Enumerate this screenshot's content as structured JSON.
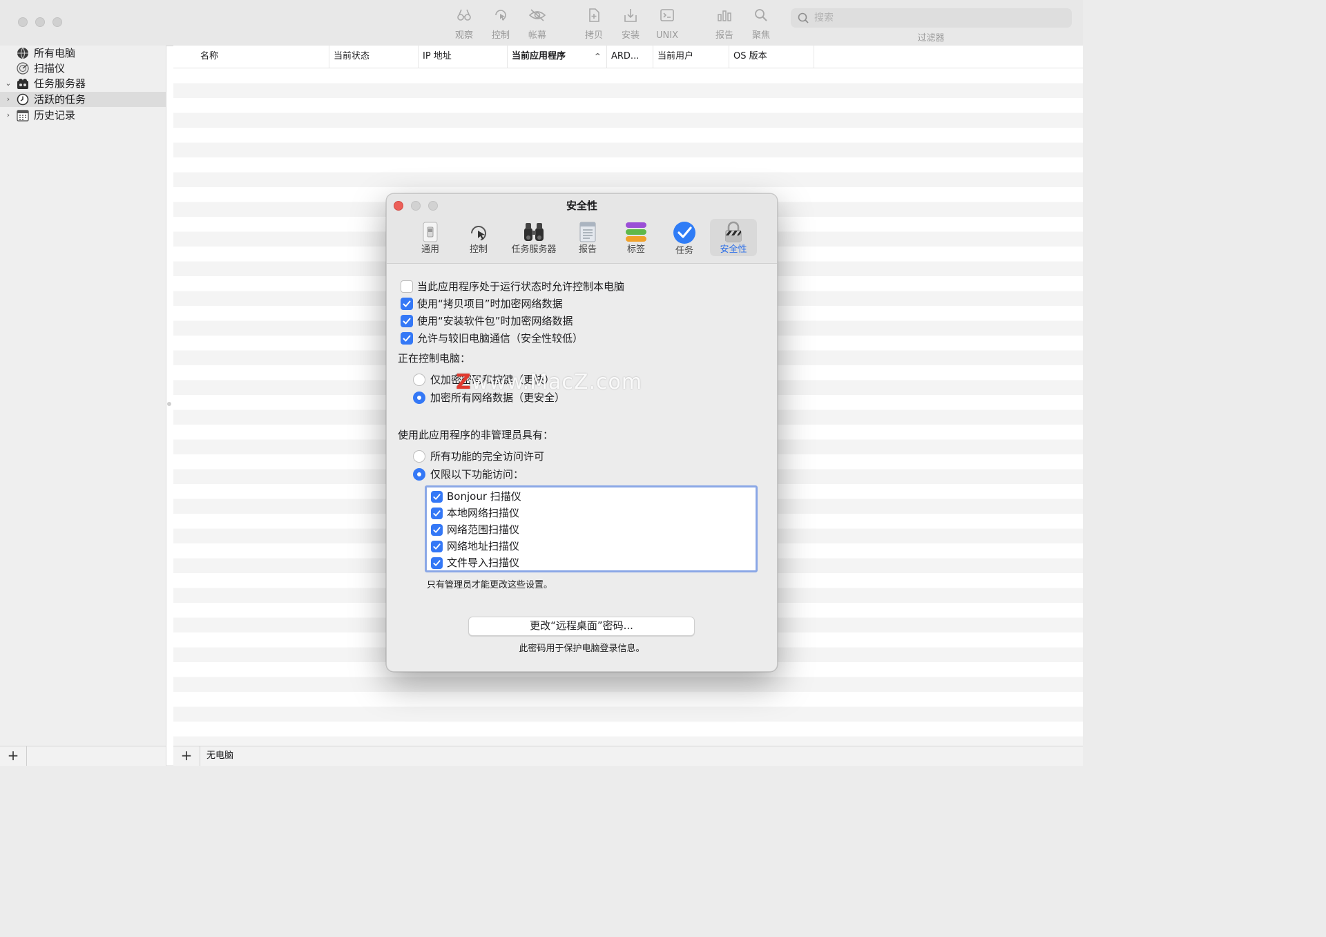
{
  "toolbar": {
    "buttons": [
      {
        "label": "观察",
        "icon": "binoculars-icon"
      },
      {
        "label": "控制",
        "icon": "control-cursor-icon"
      },
      {
        "label": "帐幕",
        "icon": "curtain-eye-icon"
      },
      {
        "label": "拷贝",
        "icon": "copy-doc-icon"
      },
      {
        "label": "安装",
        "icon": "install-box-icon"
      },
      {
        "label": "UNIX",
        "icon": "unix-terminal-icon"
      },
      {
        "label": "报告",
        "icon": "report-chart-icon"
      },
      {
        "label": "聚焦",
        "icon": "spotlight-icon"
      }
    ],
    "search_placeholder": "搜索",
    "filter_label": "过滤器"
  },
  "sidebar": {
    "items": [
      {
        "label": "所有电脑",
        "icon": "globe-icon",
        "disclosure": "",
        "selected": false
      },
      {
        "label": "扫描仪",
        "icon": "scanner-radar-icon",
        "disclosure": "",
        "selected": false
      },
      {
        "label": "任务服务器",
        "icon": "task-server-icon",
        "disclosure": "⌄",
        "selected": false
      },
      {
        "label": "活跃的任务",
        "icon": "clock-icon",
        "disclosure": "›",
        "selected": true
      },
      {
        "label": "历史记录",
        "icon": "calendar-icon",
        "disclosure": "›",
        "selected": false
      }
    ]
  },
  "table": {
    "columns": [
      {
        "label": "名称"
      },
      {
        "label": "当前状态"
      },
      {
        "label": "IP 地址"
      },
      {
        "label": "当前应用程序",
        "sorted": true,
        "caret": "^"
      },
      {
        "label": "ARD..."
      },
      {
        "label": "当前用户"
      },
      {
        "label": "OS 版本"
      }
    ],
    "rows": []
  },
  "footer": {
    "add_label": "+",
    "status": "无电脑"
  },
  "dialog": {
    "title": "安全性",
    "tabs": [
      {
        "label": "通用",
        "icon": "general-switch-icon"
      },
      {
        "label": "控制",
        "icon": "control-cursor-icon"
      },
      {
        "label": "任务服务器",
        "icon": "binoculars-icon"
      },
      {
        "label": "报告",
        "icon": "report-doc-icon"
      },
      {
        "label": "标签",
        "icon": "tags-stack-icon"
      },
      {
        "label": "任务",
        "icon": "task-check-icon"
      },
      {
        "label": "安全性",
        "icon": "lock-icon",
        "active": true
      }
    ],
    "options": [
      {
        "label": "当此应用程序处于运行状态时允许控制本电脑",
        "checked": false
      },
      {
        "label": "使用“拷贝项目”时加密网络数据",
        "checked": true
      },
      {
        "label": "使用“安装软件包”时加密网络数据",
        "checked": true
      },
      {
        "label": "允许与较旧电脑通信（安全性较低）",
        "checked": true
      }
    ],
    "control_section": {
      "label": "正在控制电脑：",
      "choices": [
        {
          "label": "仅加密密码和按键（更快）",
          "selected": false
        },
        {
          "label": "加密所有网络数据（更安全）",
          "selected": true
        }
      ]
    },
    "nonadmin_section": {
      "label": "使用此应用程序的非管理员具有：",
      "choices": [
        {
          "label": "所有功能的完全访问许可",
          "selected": false
        },
        {
          "label": "仅限以下功能访问：",
          "selected": true
        }
      ],
      "features": [
        {
          "label": "Bonjour 扫描仪",
          "checked": true
        },
        {
          "label": "本地网络扫描仪",
          "checked": true
        },
        {
          "label": "网络范围扫描仪",
          "checked": true
        },
        {
          "label": "网络地址扫描仪",
          "checked": true
        },
        {
          "label": "文件导入扫描仪",
          "checked": true
        }
      ]
    },
    "admin_note": "只有管理员才能更改这些设置。",
    "password_button": "更改“远程桌面”密码...",
    "password_note": "此密码用于保护电脑登录信息。"
  },
  "watermark": {
    "z": "Z",
    "text": "www.MacZ.com"
  },
  "colors": {
    "accent": "#3478f6",
    "close": "#ec5f58",
    "active_tab_text": "#2b6ee8"
  }
}
